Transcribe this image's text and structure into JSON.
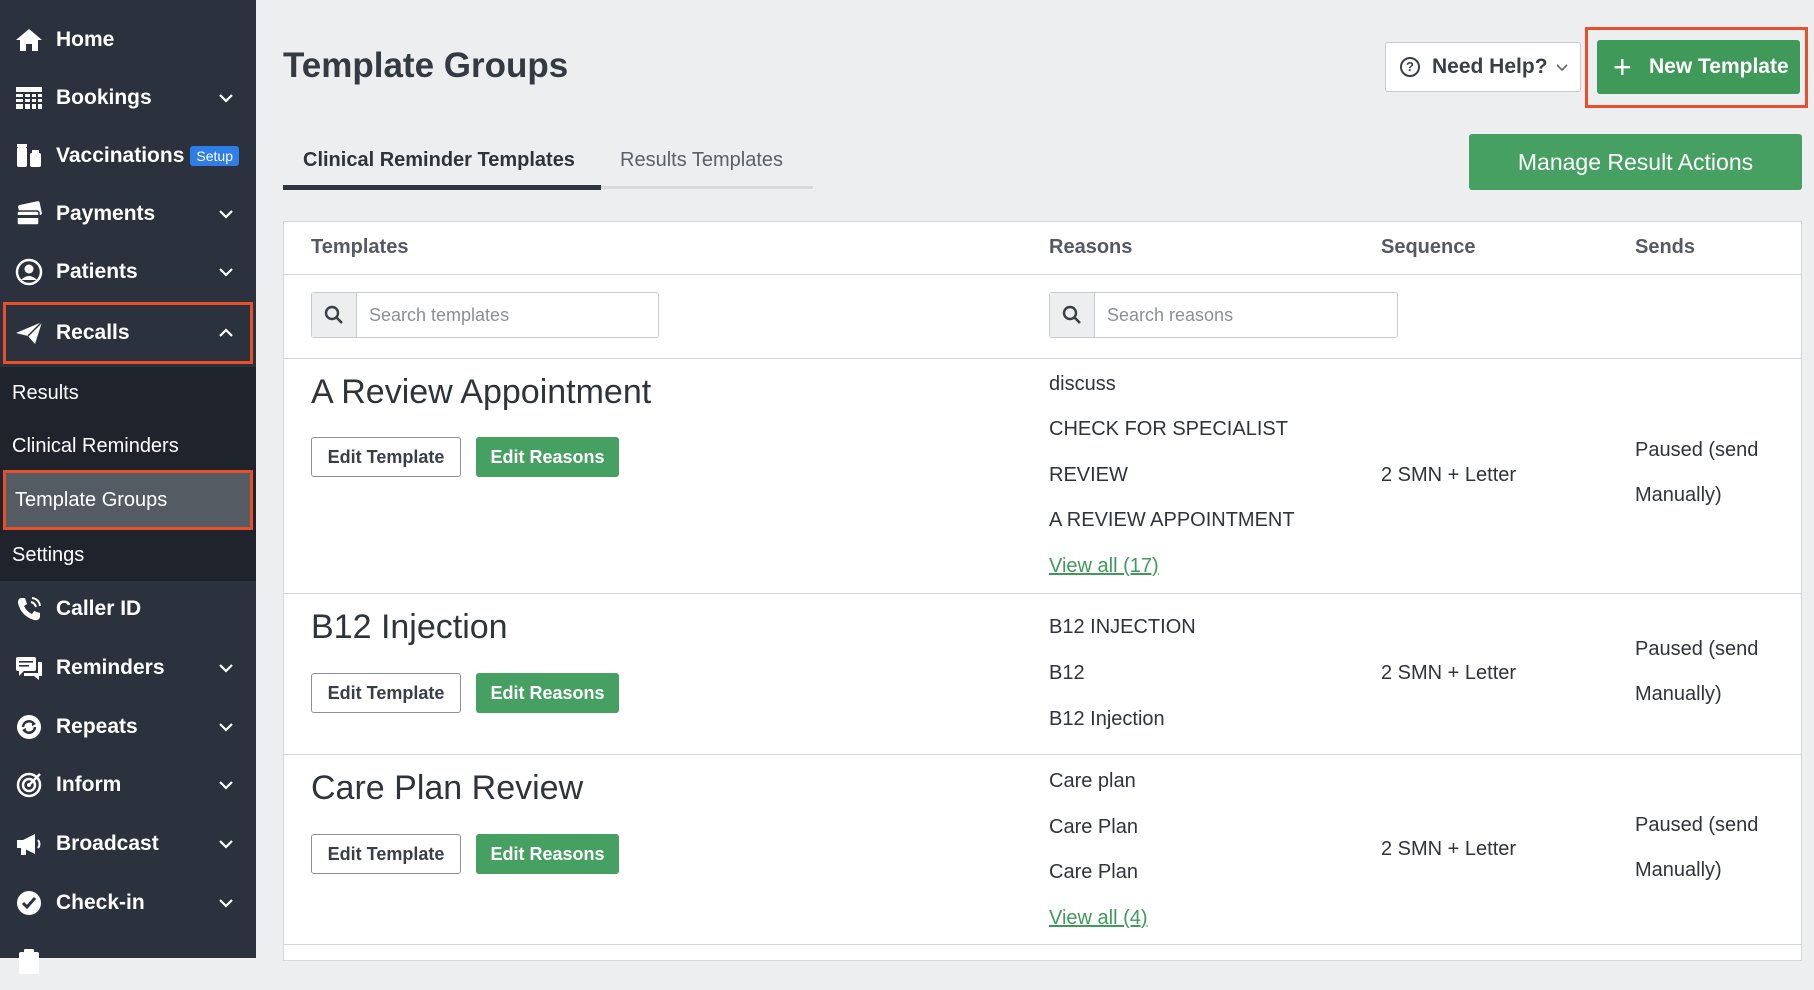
{
  "sidebar": {
    "items": [
      {
        "label": "Home",
        "icon": "home-icon",
        "chevron": false
      },
      {
        "label": "Bookings",
        "icon": "grid-icon",
        "chevron": true
      },
      {
        "label": "Vaccinations",
        "icon": "vaccine-icon",
        "chevron": false,
        "badge": "Setup"
      },
      {
        "label": "Payments",
        "icon": "payment-icon",
        "chevron": true
      },
      {
        "label": "Patients",
        "icon": "user-circle-icon",
        "chevron": true
      },
      {
        "label": "Recalls",
        "icon": "paper-plane-icon",
        "chevron": "up"
      },
      {
        "label": "Caller ID",
        "icon": "phone-icon",
        "chevron": false
      },
      {
        "label": "Reminders",
        "icon": "chat-icon",
        "chevron": true
      },
      {
        "label": "Repeats",
        "icon": "refresh-icon",
        "chevron": true
      },
      {
        "label": "Inform",
        "icon": "target-icon",
        "chevron": true
      },
      {
        "label": "Broadcast",
        "icon": "megaphone-icon",
        "chevron": true
      },
      {
        "label": "Check-in",
        "icon": "check-badge-icon",
        "chevron": true
      }
    ],
    "recalls_submenu": [
      "Results",
      "Clinical Reminders",
      "Template Groups",
      "Settings"
    ],
    "active_submenu": "Template Groups"
  },
  "header": {
    "title": "Template Groups",
    "help_label": "Need Help?",
    "new_template_label": "New Template"
  },
  "tabs": [
    {
      "label": "Clinical Reminder Templates",
      "active": true
    },
    {
      "label": "Results Templates",
      "active": false
    }
  ],
  "manage_label": "Manage Result Actions",
  "table": {
    "columns": [
      "Templates",
      "Reasons",
      "Sequence",
      "Sends"
    ],
    "search_templates_placeholder": "Search templates",
    "search_reasons_placeholder": "Search reasons",
    "edit_template_label": "Edit Template",
    "edit_reasons_label": "Edit Reasons",
    "rows": [
      {
        "name": "A Review Appointment",
        "reasons": [
          "discuss",
          "CHECK FOR SPECIALIST",
          "REVIEW",
          "A REVIEW APPOINTMENT"
        ],
        "view_all": "View all (17)",
        "sequence": "2 SMN + Letter",
        "sends": "Paused (send Manually)"
      },
      {
        "name": "B12 Injection",
        "reasons": [
          "B12 INJECTION",
          "B12",
          "B12 Injection"
        ],
        "view_all": "",
        "sequence": "2 SMN + Letter",
        "sends": "Paused (send Manually)"
      },
      {
        "name": "Care Plan Review",
        "reasons": [
          "Care plan",
          "Care Plan",
          "Care Plan"
        ],
        "view_all": "View all (4)",
        "sequence": "2 SMN + Letter",
        "sends": "Paused (send Manually)"
      }
    ]
  },
  "colors": {
    "sidebar_bg": "#2b323d",
    "submenu_bg": "#1f242c",
    "accent_green": "#45a062",
    "highlight_red": "#e8502c"
  }
}
